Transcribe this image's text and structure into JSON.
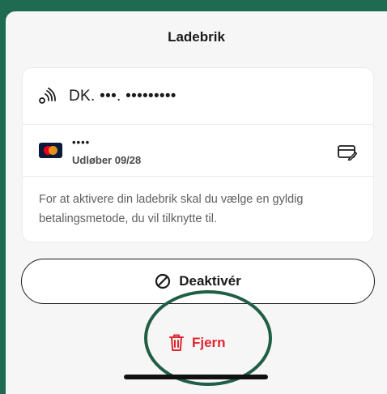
{
  "sheet": {
    "title": "Ladebrik"
  },
  "charger": {
    "id_prefix": "DK.",
    "id_masked": "•••. •••••••••"
  },
  "payment": {
    "card_brand_icon": "mastercard-logo",
    "masked_number": "••••",
    "expiry": "Udløber 09/28"
  },
  "info": {
    "text": "For at aktivere din ladebrik skal du vælge en gyldig betalingsmetode, du vil tilknytte til."
  },
  "actions": {
    "deactivate_label": "Deaktivér",
    "remove_label": "Fjern"
  },
  "colors": {
    "accent_red": "#e0262f",
    "highlight_green": "#1f5f45"
  }
}
